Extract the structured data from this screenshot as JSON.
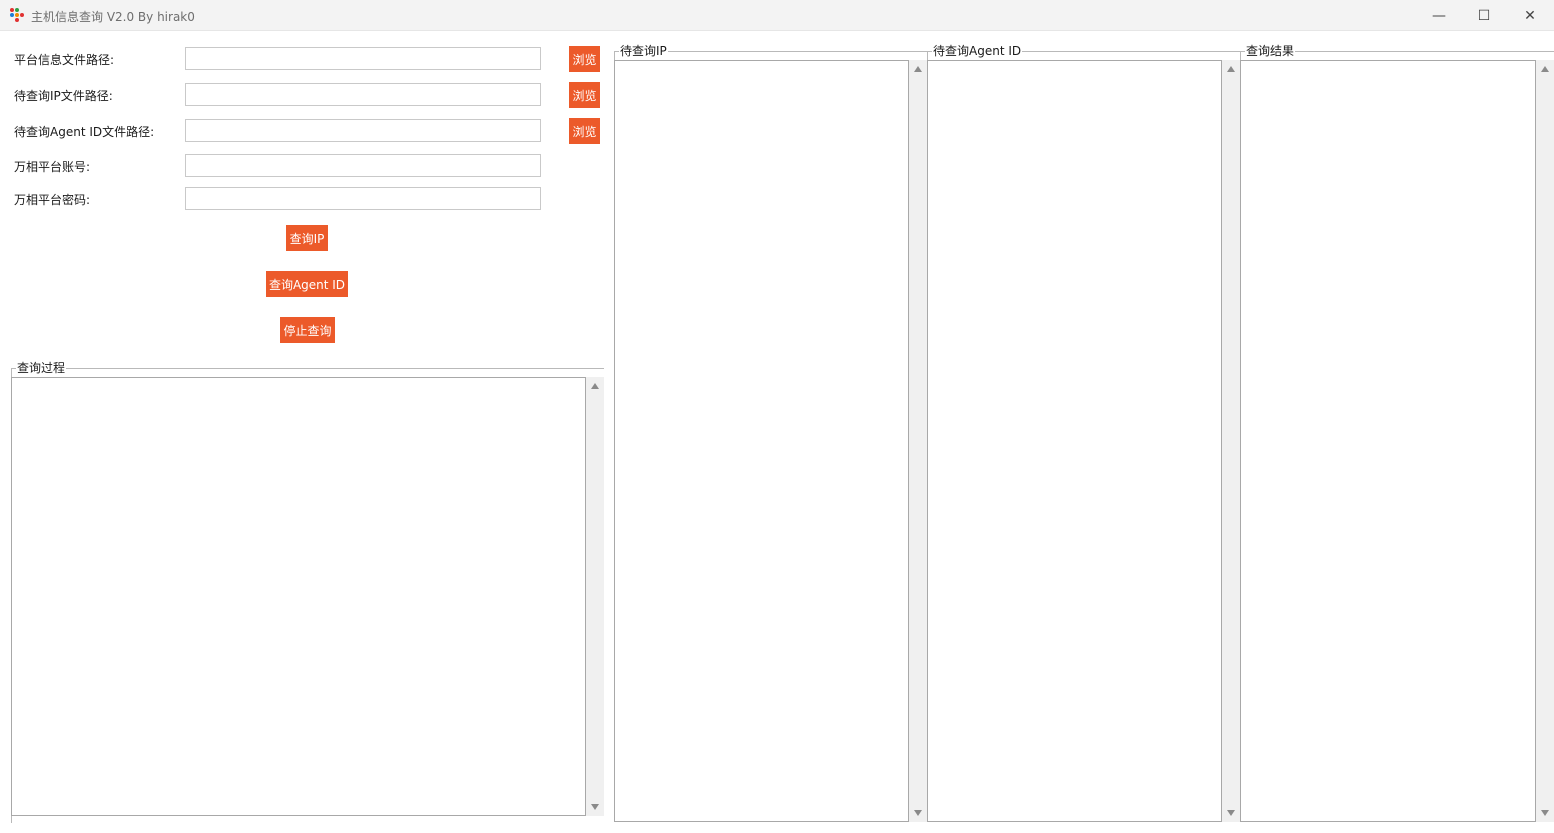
{
  "window": {
    "title": "主机信息查询 V2.0 By hirak0",
    "controls": {
      "minimize": "—",
      "maximize": "☐",
      "close": "✕"
    }
  },
  "form": {
    "platform_info_path_label": "平台信息文件路径:",
    "ip_file_path_label": "待查询IP文件路径:",
    "agent_id_file_path_label": "待查询Agent ID文件路径:",
    "account_label": "万相平台账号:",
    "password_label": "万相平台密码:",
    "platform_info_path_value": "",
    "ip_file_path_value": "",
    "agent_id_file_path_value": "",
    "account_value": "",
    "password_value": "",
    "browse_label": "浏览"
  },
  "actions": {
    "query_ip": "查询IP",
    "query_agent_id": "查询Agent ID",
    "stop_query": "停止查询"
  },
  "panels": {
    "query_process": "查询过程",
    "pending_ip": "待查询IP",
    "pending_agent_id": "待查询Agent ID",
    "query_result": "查询结果"
  },
  "colors": {
    "accent": "#ec5a2a",
    "titlebar_bg": "#f3f3f3",
    "scrollbar_bg": "#f0f0f0"
  }
}
